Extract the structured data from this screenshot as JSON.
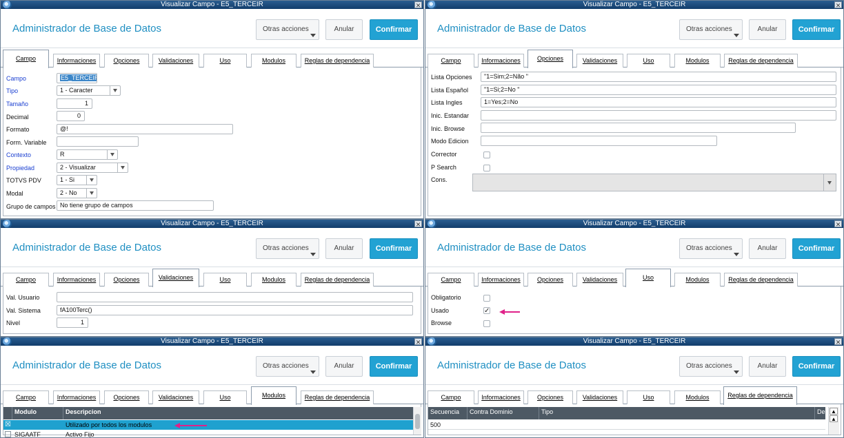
{
  "window_title": "Visualizar Campo - E5_TERCEIR",
  "app_title": "Administrador de Base de Datos",
  "buttons": {
    "otras": "Otras acciones",
    "anular": "Anular",
    "confirmar": "Confirmar"
  },
  "tabs": [
    "Campo",
    "Informaciones",
    "Opciones",
    "Validaciones",
    "Uso",
    "Modulos",
    "Reglas de dependencia"
  ],
  "campo": {
    "rows": [
      {
        "label": "Campo",
        "value": "E5_TERCEIR"
      },
      {
        "label": "Tipo",
        "value": "1 - Caracter"
      },
      {
        "label": "Tamaño",
        "value": "1"
      },
      {
        "label": "Decimal",
        "value": "0"
      },
      {
        "label": "Formato",
        "value": "@!"
      },
      {
        "label": "Form. Variable",
        "value": ""
      },
      {
        "label": "Contexto",
        "value": "R"
      },
      {
        "label": "Propiedad",
        "value": "2 - Visualizar"
      },
      {
        "label": "TOTVS PDV",
        "value": "1 - Si"
      },
      {
        "label": "Modal",
        "value": "2 - No"
      },
      {
        "label": "Grupo de campos",
        "value": "No tiene grupo de campos"
      }
    ]
  },
  "opciones": {
    "rows": [
      {
        "label": "Lista Opciones",
        "value": "\"1=Sim;2=Não \""
      },
      {
        "label": "Lista Español",
        "value": "\"1=Si;2=No \""
      },
      {
        "label": "Lista Ingles",
        "value": "1=Yes;2=No"
      },
      {
        "label": "Inic. Estandar",
        "value": ""
      },
      {
        "label": "Inic. Browse",
        "value": ""
      },
      {
        "label": "Modo Edicion",
        "value": ""
      },
      {
        "label": "Corrector",
        "value": ""
      },
      {
        "label": "P Search",
        "value": ""
      },
      {
        "label": "Cons.",
        "value": ""
      }
    ]
  },
  "validaciones": {
    "rows": [
      {
        "label": "Val. Usuario",
        "value": ""
      },
      {
        "label": "Val. Sistema",
        "value": "fA100Terc()"
      },
      {
        "label": "Nivel",
        "value": "1"
      }
    ]
  },
  "uso": {
    "rows": [
      {
        "label": "Obligatorio",
        "checked": ""
      },
      {
        "label": "Usado",
        "checked": "✓"
      },
      {
        "label": "Browse",
        "checked": ""
      }
    ]
  },
  "modulos": {
    "headers": [
      "Modulo",
      "Descripcion"
    ],
    "rows": [
      {
        "check": "☒",
        "modulo": "",
        "descripcion": "Utilizado por todos los modulos"
      },
      {
        "check": "",
        "modulo": "SIGAATF",
        "descripcion": "Activo Fijo"
      }
    ]
  },
  "reglas": {
    "headers": [
      "Secuencia",
      "Contra Dominio",
      "Tipo",
      "De"
    ],
    "rows": [
      {
        "secuencia": "500",
        "contra": "",
        "tipo": ""
      }
    ]
  },
  "colors": {
    "accent": "#22a2d3",
    "title": "#1f8fc2",
    "highlight_arrow": "#e02189",
    "grid_header": "#4d5964",
    "grid_selected": "#1fa1cf"
  }
}
